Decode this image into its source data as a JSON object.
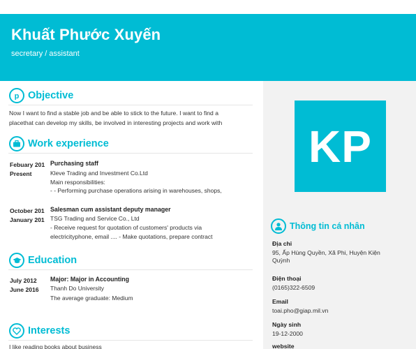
{
  "header": {
    "name": "Khuất Phước Xuyến",
    "role": "secretary / assistant"
  },
  "avatar": {
    "initials": "KP"
  },
  "objective": {
    "title": "Objective",
    "text_line1": "Now I want to find a stable job and be able to stick to the future. I want to find a",
    "text_line2": "placethat can develop my skills, be involved in interesting projects and work with"
  },
  "work": {
    "title": "Work experience",
    "items": [
      {
        "date_from": "Febuary 201",
        "date_to": "Present",
        "title": "Purchasing staff",
        "company": "Kleve Trading and Investment Co.Ltd",
        "line1": "Main responsibilities:",
        "line2": "- - Performing purchase operations arising in warehouses, shops,"
      },
      {
        "date_from": "October 201",
        "date_to": "January 201",
        "title": "Salesman cum assistant deputy manager",
        "company": "TSG Trading and Service Co., Ltd",
        "line1": "- Receive request for quotation of customers' products via",
        "line2": "electricityphone, email .... - Make quotations, prepare contract"
      }
    ]
  },
  "education": {
    "title": "Education",
    "date_from": "July 2012",
    "date_to": "June 2016",
    "major": "Major: Major in Accounting",
    "school": "Thanh Do University",
    "grade": "The average graduate: Medium"
  },
  "interests": {
    "title": "Interests",
    "text": "I like reading books about business"
  },
  "personal": {
    "title": "Thông tin cá nhân",
    "address_label": "Địa chỉ",
    "address_line1": "95, Ấp Hùng Quyền, Xã Phi, Huyện Kiện",
    "address_line2": "Quỳnh",
    "phone_label": "Điện thoại",
    "phone": "(0165)322-6509",
    "email_label": "Email",
    "email": "toai.pho@giap.mil.vn",
    "dob_label": "Ngày sinh",
    "dob": "19-12-2000",
    "website_label": "website"
  },
  "colors": {
    "accent": "#00bcd4",
    "sidebar_bg": "#f2f2f2"
  },
  "icons": {
    "objective": "pinterest-icon",
    "work": "briefcase-icon",
    "education": "graduation-cap-icon",
    "interests": "heart-icon",
    "personal": "user-icon"
  }
}
